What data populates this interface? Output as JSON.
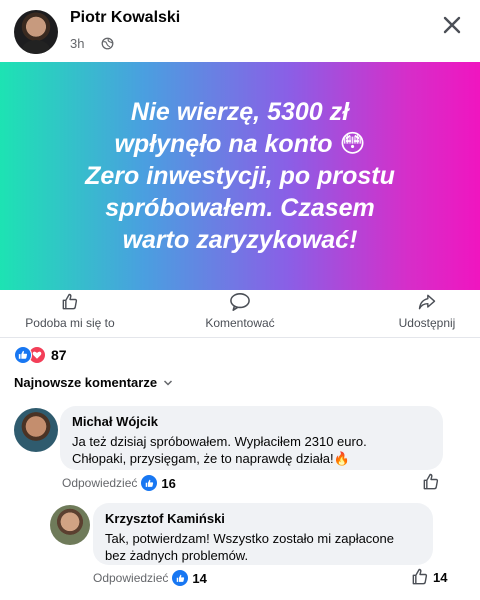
{
  "post": {
    "author": "Piotr Kowalski",
    "time": "3h",
    "banner_lines": [
      "Nie wierzę, 5300 zł",
      "wpłynęło na konto 😳",
      "Zero inwestycji, po prostu",
      "spróbowałem. Czasem",
      "warto zaryzykować!"
    ],
    "banner_colors": [
      "#1de3b3",
      "#4a9fe0",
      "#8a5fe6",
      "#d62ec9",
      "#f015c0"
    ]
  },
  "actions": {
    "like_label": "Podoba mi się to",
    "comment_label": "Komentować",
    "share_label": "Udostępnij"
  },
  "reactions": {
    "count": "87",
    "types": [
      "like",
      "love"
    ]
  },
  "comments_sort": "Najnowsze komentarze",
  "comments": [
    {
      "name": "Michał Wójcik",
      "text_line1": "Ja też dzisiaj spróbowałem. Wypłaciłem 2310 euro.",
      "text_line2": "Chłopaki, przysięgam, że to naprawdę działa!",
      "emoji": "🔥",
      "reply_label": "Odpowiedzieć",
      "likes": "16"
    },
    {
      "name": "Krzysztof Kamiński",
      "text_line1": "Tak, potwierdzam! Wszystko zostało mi zapłacone",
      "text_line2": "bez żadnych problemów.",
      "reply_label": "Odpowiedzieć",
      "likes": "14",
      "like_button_count": "14"
    }
  ],
  "colors": {
    "facebook_blue": "#1877f2",
    "love_red": "#f33e58",
    "bubble_bg": "#f0f2f5"
  }
}
